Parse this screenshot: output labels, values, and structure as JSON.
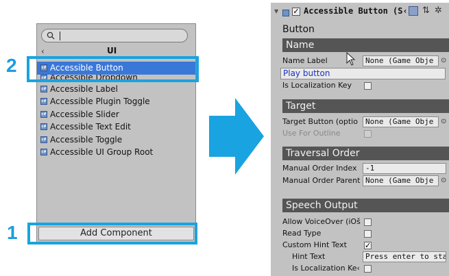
{
  "left_panel": {
    "search": {
      "value": "",
      "placeholder": ""
    },
    "header": {
      "back_icon": "chevron-left-icon",
      "title": "UI"
    },
    "items": [
      {
        "label": "Accessible Button",
        "selected": true
      },
      {
        "label": "Accessible Dropdown",
        "selected": false
      },
      {
        "label": "Accessible Label",
        "selected": false
      },
      {
        "label": "Accessible Plugin Toggle",
        "selected": false
      },
      {
        "label": "Accessible Slider",
        "selected": false
      },
      {
        "label": "Accessible Text Edit",
        "selected": false
      },
      {
        "label": "Accessible Toggle",
        "selected": false
      },
      {
        "label": "Accessible UI Group Root",
        "selected": false
      }
    ],
    "add_component_label": "Add Component"
  },
  "annotations": {
    "step_1": "1",
    "step_2": "2",
    "highlight_color": "#19a3e0"
  },
  "inspector": {
    "component_title": "Accessible Button (S‹",
    "enabled": true,
    "subtitle": "Button",
    "sections": {
      "name": {
        "title": "Name",
        "name_label": {
          "label": "Name Label",
          "value": "None (Game Obje"
        },
        "text_value": "Play button",
        "is_localization_key": {
          "label": "Is Localization Key",
          "checked": false
        }
      },
      "target": {
        "title": "Target",
        "target_button": {
          "label": "Target Button (optio",
          "value": "None (Game Obje"
        },
        "use_for_outline": {
          "label": "Use For Outline",
          "checked": false,
          "disabled": true
        }
      },
      "traversal": {
        "title": "Traversal Order",
        "manual_order_index": {
          "label": "Manual Order Index",
          "value": "-1"
        },
        "manual_order_parent": {
          "label": "Manual Order Parent",
          "value": "None (Game Obje"
        }
      },
      "speech": {
        "title": "Speech Output",
        "allow_voiceover": {
          "label": "Allow VoiceOver (iOš",
          "checked": false
        },
        "read_type": {
          "label": "Read Type",
          "checked": false
        },
        "custom_hint_text": {
          "label": "Custom Hint Text",
          "checked": true
        },
        "hint_text": {
          "label": "Hint Text",
          "value": "Press enter to start"
        },
        "hint_is_localization_key": {
          "label": "Is Localization Ke‹",
          "checked": false
        }
      }
    }
  },
  "colors": {
    "selection": "#3a78d8",
    "section_header": "#555555",
    "panel": "#c2c2c2",
    "arrow": "#19a3e0"
  }
}
